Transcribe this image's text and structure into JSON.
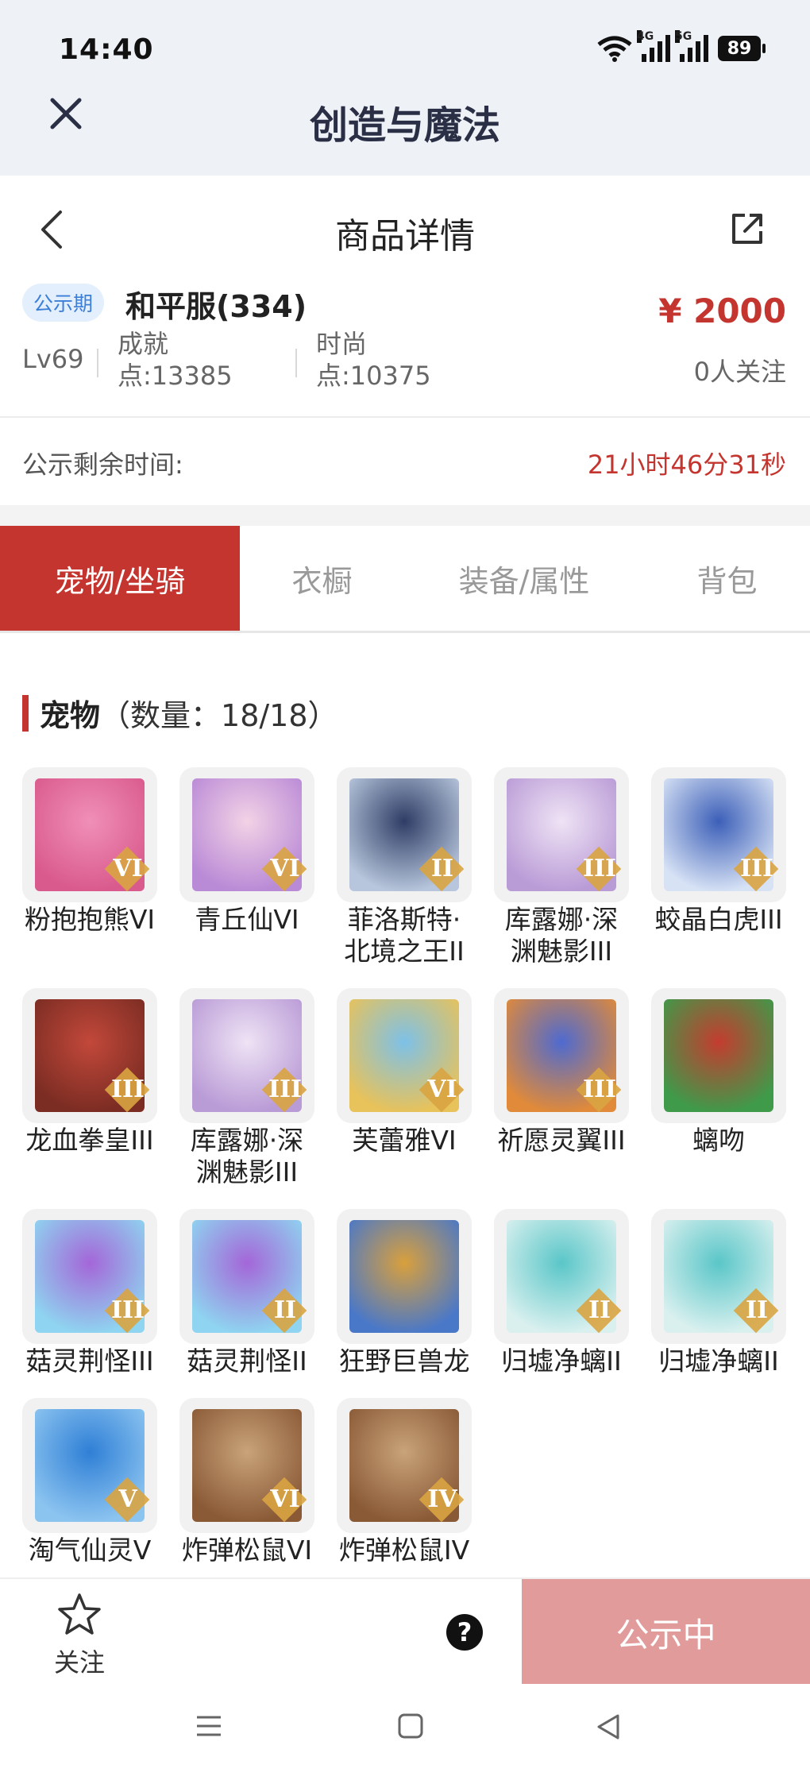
{
  "status_bar": {
    "time": "14:40",
    "battery": "89",
    "net1": "4G",
    "net2": "5G"
  },
  "app": {
    "title": "创造与魔法"
  },
  "page": {
    "title": "商品详情"
  },
  "listing": {
    "badge": "公示期",
    "server": "和平服(334)",
    "price": "¥ 2000",
    "followers": "0人关注",
    "level": "Lv69",
    "achievement_line1": "成就",
    "achievement_line2": "点:13385",
    "fashion_line1": "时尚",
    "fashion_line2": "点:10375"
  },
  "timer": {
    "label": "公示剩余时间:",
    "value": "21小时46分31秒"
  },
  "tabs": [
    {
      "label": "宠物/坐骑",
      "active": true
    },
    {
      "label": "衣橱",
      "active": false
    },
    {
      "label": "装备/属性",
      "active": false
    },
    {
      "label": "背包",
      "active": false
    }
  ],
  "pets_section": {
    "title": "宠物",
    "count": "（数量：18/18）"
  },
  "pets": [
    {
      "name": "粉抱抱熊VI",
      "grade": "VI",
      "colors": [
        "#f08fb8",
        "#d95a8c"
      ]
    },
    {
      "name": "青丘仙VI",
      "grade": "VI",
      "colors": [
        "#f3d2e6",
        "#b98ad6"
      ]
    },
    {
      "name": "菲洛斯特·北境之王II",
      "grade": "II",
      "colors": [
        "#2f3d66",
        "#b7c6dc"
      ]
    },
    {
      "name": "库露娜·深渊魅影III",
      "grade": "III",
      "colors": [
        "#efe3f5",
        "#b99bd6"
      ]
    },
    {
      "name": "蛟晶白虎III",
      "grade": "III",
      "colors": [
        "#3c5fb8",
        "#d7e2f5"
      ]
    },
    {
      "name": "龙血拳皇III",
      "grade": "III",
      "colors": [
        "#c2483a",
        "#7b2c23"
      ]
    },
    {
      "name": "库露娜·深渊魅影III",
      "grade": "III",
      "colors": [
        "#efe3f5",
        "#b99bd6"
      ]
    },
    {
      "name": "芙蕾雅VI",
      "grade": "VI",
      "colors": [
        "#7dc1e8",
        "#e8c25a"
      ]
    },
    {
      "name": "祈愿灵翼III",
      "grade": "III",
      "colors": [
        "#4e6ad0",
        "#e08a3a"
      ]
    },
    {
      "name": "螭吻",
      "grade": "",
      "colors": [
        "#c43c2f",
        "#3f9a4a"
      ]
    },
    {
      "name": "菇灵荆怪III",
      "grade": "III",
      "colors": [
        "#a466d8",
        "#8fd4f0"
      ]
    },
    {
      "name": "菇灵荆怪II",
      "grade": "II",
      "colors": [
        "#a466d8",
        "#8fd4f0"
      ]
    },
    {
      "name": "狂野巨兽龙",
      "grade": "",
      "colors": [
        "#d9a03c",
        "#4a78c8"
      ]
    },
    {
      "name": "归墟净螭II",
      "grade": "II",
      "colors": [
        "#5ac6c8",
        "#d9f0ef"
      ]
    },
    {
      "name": "归墟净螭II",
      "grade": "II",
      "colors": [
        "#5ac6c8",
        "#d9f0ef"
      ]
    },
    {
      "name": "淘气仙灵V",
      "grade": "V",
      "colors": [
        "#2f7fd6",
        "#8cc4f0"
      ]
    },
    {
      "name": "炸弹松鼠VI",
      "grade": "VI",
      "colors": [
        "#c9a37a",
        "#8a5a36"
      ]
    },
    {
      "name": "炸弹松鼠IV",
      "grade": "IV",
      "colors": [
        "#c9a37a",
        "#8a5a36"
      ]
    }
  ],
  "bottom": {
    "follow_label": "关注",
    "help_label": "?",
    "status_button": "公示中"
  }
}
